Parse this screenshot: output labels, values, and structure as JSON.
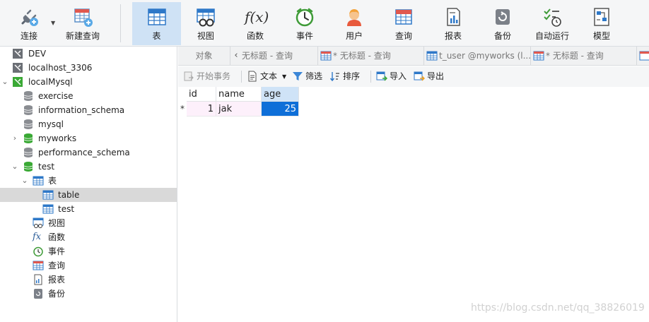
{
  "ribbon": {
    "connect_label": "连接",
    "new_query_label": "新建查询",
    "table_label": "表",
    "view_label": "视图",
    "function_label": "函数",
    "event_label": "事件",
    "user_label": "用户",
    "query_label": "查询",
    "report_label": "报表",
    "backup_label": "备份",
    "automation_label": "自动运行",
    "model_label": "模型",
    "function_glyph": "f(x)"
  },
  "tree": {
    "dev": "DEV",
    "localhost": "localhost_3306",
    "local_mysql": "localMysql",
    "db_exercise": "exercise",
    "db_information_schema": "information_schema",
    "db_mysql": "mysql",
    "db_myworks": "myworks",
    "db_performance_schema": "performance_schema",
    "db_test": "test",
    "tables_folder": "表",
    "table_table": "table",
    "table_test": "test",
    "views_folder": "视图",
    "functions_folder": "函数",
    "events_folder": "事件",
    "queries_folder": "查询",
    "reports_folder": "报表",
    "backups_folder": "备份",
    "function_glyph": "fx"
  },
  "tabs": {
    "objects": "对象",
    "tab1": "无标题 - 查询",
    "tab2": "* 无标题 - 查询",
    "tab3": "t_user @myworks (l...",
    "tab4": "* 无标题 - 查询"
  },
  "toolbar": {
    "begin_transaction": "开始事务",
    "text": "文本",
    "filter": "筛选",
    "sort": "排序",
    "import": "导入",
    "export": "导出"
  },
  "grid": {
    "columns": [
      "id",
      "name",
      "age"
    ],
    "row_marker": "*",
    "rows": [
      {
        "id": "1",
        "name": "jak",
        "age": "25"
      }
    ]
  },
  "watermark": "https://blog.csdn.net/qq_38826019"
}
